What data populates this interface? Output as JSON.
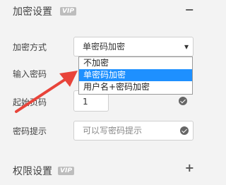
{
  "sections": {
    "encryption": {
      "title": "加密设置",
      "vip": "VIP",
      "toggle": "−"
    },
    "permissions": {
      "title": "权限设置",
      "vip": "VIP",
      "toggle": "+"
    }
  },
  "rows": {
    "method_label": "加密方式",
    "method_value": "单密码加密",
    "password_label": "输入密码",
    "start_page_label": "起始页码",
    "start_page_value": "1",
    "hint_label": "密码提示",
    "hint_placeholder": "可以写密码提示"
  },
  "dropdown": {
    "options": [
      "不加密",
      "单密码加密",
      "用户名+密码加密"
    ],
    "selected_index": 1
  },
  "colors": {
    "accent": "#1e90ff",
    "arrow": "#e8443a"
  },
  "icons": {
    "select_arrow": "▾",
    "check": "check-circle-icon",
    "annotation": "red-arrow"
  }
}
